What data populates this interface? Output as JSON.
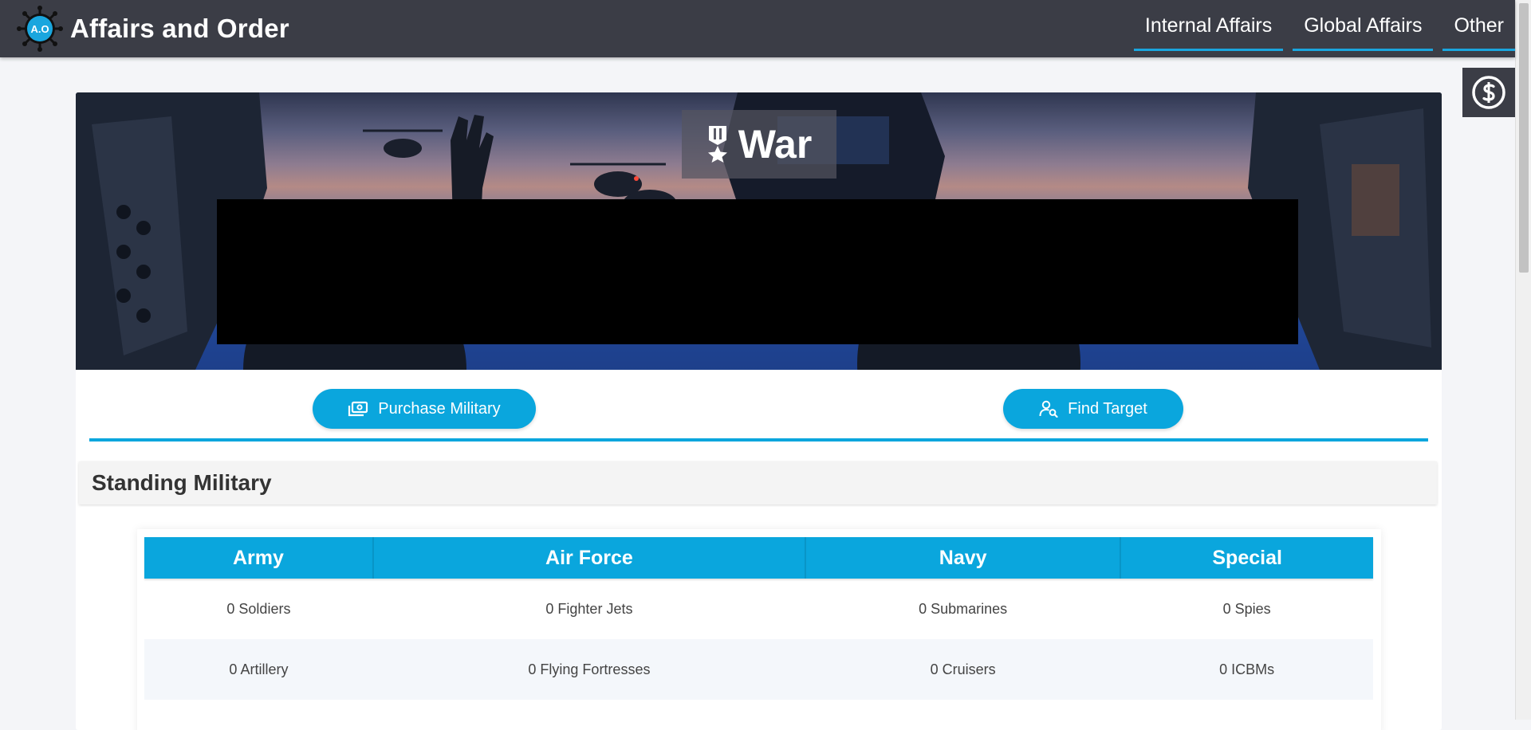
{
  "app": {
    "title": "Affairs and Order",
    "logo_text": "A.O"
  },
  "nav": {
    "items": [
      {
        "label": "Internal Affairs"
      },
      {
        "label": "Global Affairs"
      },
      {
        "label": "Other"
      }
    ]
  },
  "hero": {
    "title": "War",
    "title_icon": "medal-star-icon"
  },
  "actions": {
    "purchase_label": "Purchase Military",
    "purchase_icon": "money-icon",
    "find_label": "Find Target",
    "find_icon": "user-search-icon"
  },
  "currency_icon": "dollar-circle-icon",
  "section": {
    "title": "Standing Military"
  },
  "table": {
    "headers": [
      "Army",
      "Air Force",
      "Navy",
      "Special"
    ],
    "rows": [
      [
        "0 Soldiers",
        "0 Fighter Jets",
        "0 Submarines",
        "0 Spies"
      ],
      [
        "0 Artillery",
        "0 Flying Fortresses",
        "0 Cruisers",
        "0 ICBMs"
      ]
    ]
  },
  "colors": {
    "navbar": "#3b3d46",
    "accent": "#0aa6dd",
    "nav_underline": "#1aa6de"
  }
}
